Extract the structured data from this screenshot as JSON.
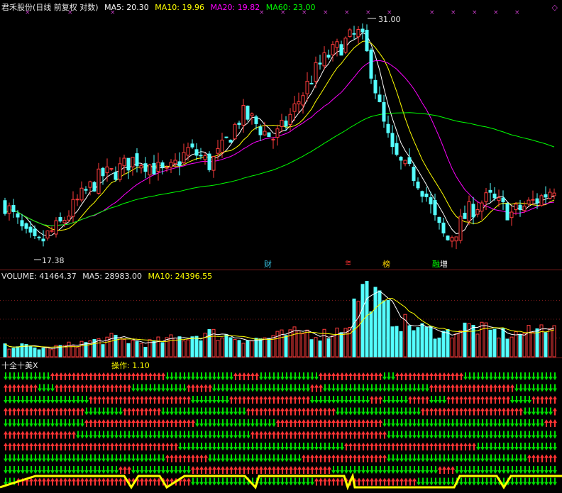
{
  "price": {
    "title": "君禾股份(日线 前复权 对数)",
    "ma": [
      {
        "label": "MA5: 20.30",
        "color": "#ffffff"
      },
      {
        "label": "MA10: 19.96",
        "color": "#ffff00"
      },
      {
        "label": "MA20: 19.82",
        "color": "#ff00ff"
      },
      {
        "label": "MA60: 23.00",
        "color": "#00ff00"
      }
    ],
    "high_label": "31.00",
    "low_label": "17.38",
    "event_tags": [
      {
        "text": "财",
        "color": "#39c5e6"
      },
      {
        "text": "≋",
        "color": "#ff3030"
      },
      {
        "text": "榜",
        "color": "#ffd700"
      },
      {
        "text": "融",
        "color": "#00ff00"
      },
      {
        "text": "增",
        "color": "#ffffff"
      }
    ]
  },
  "volume": {
    "label": "VOLUME: 41464.37",
    "ma5": "MA5: 28983.00",
    "ma10": "MA10: 24396.55"
  },
  "signal": {
    "title": "十全十美X",
    "op": "操作: 1.10"
  },
  "colors": {
    "up": "#ff3c3c",
    "down": "#54ffff",
    "ma5": "#ffffff",
    "ma10": "#ffff00",
    "ma20": "#ff00ff",
    "ma60": "#00ff00",
    "arrow_up": "#ff3333",
    "arrow_down": "#00dd00",
    "op_line": "#ffff00"
  },
  "chart_data": {
    "type": "candlestick",
    "scale": "log",
    "high": 31.0,
    "low": 17.38,
    "close_path": [
      19.4,
      18.6,
      17.8,
      17.4,
      17.9,
      18.3,
      19.0,
      19.7,
      20.3,
      20.9,
      21.0,
      21.4,
      21.8,
      21.6,
      21.3,
      20.9,
      21.6,
      22.3,
      22.0,
      21.5,
      22.2,
      23.3,
      24.5,
      24.1,
      23.4,
      23.0,
      23.8,
      25.0,
      26.3,
      27.6,
      28.5,
      29.1,
      29.8,
      30.2,
      27.5,
      24.2,
      22.1,
      21.3,
      20.9,
      20.0,
      18.5,
      17.6,
      18.2,
      19.0,
      19.4,
      19.7,
      19.3,
      18.9,
      19.2,
      19.5,
      19.8,
      20.3
    ],
    "volume_path": [
      6,
      7,
      6,
      5,
      5,
      6,
      7,
      8,
      9,
      10,
      11,
      10,
      9,
      8,
      9,
      10,
      11,
      12,
      13,
      14,
      13,
      12,
      11,
      10,
      11,
      12,
      13,
      14,
      15,
      13,
      14,
      16,
      22,
      41,
      38,
      30,
      24,
      20,
      18,
      16,
      15,
      14,
      16,
      18,
      17,
      15,
      14,
      13,
      14,
      15,
      18,
      23
    ]
  }
}
